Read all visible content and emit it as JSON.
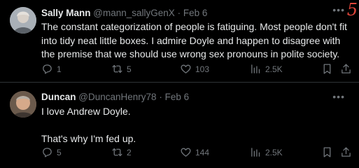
{
  "annotation": "5",
  "tweets": [
    {
      "name": "Sally Mann",
      "handle": "@mann_sallyGenX",
      "date": "Feb 6",
      "text": "The constant categorization of people is fatiguing. Most people don't fit into tidy neat little boxes. I admire Doyle and happen to disagree with the premise that we should use wrong sex pronouns in polite society.",
      "replies": "1",
      "retweets": "5",
      "likes": "103",
      "views": "2.5K"
    },
    {
      "name": "Duncan",
      "handle": "@DuncanHenry78",
      "date": "Feb 6",
      "text": "I love Andrew Doyle.\n\nThat's why I'm fed up.",
      "replies": "5",
      "retweets": "2",
      "likes": "144",
      "views": "2.5K"
    }
  ],
  "colors": {
    "background": "#000000",
    "text": "#e7e9ea",
    "secondary": "#71767b",
    "divider": "#2f3336",
    "annotation": "#e0453a"
  },
  "icons": [
    "reply-icon",
    "retweet-icon",
    "like-icon",
    "views-icon",
    "bookmark-icon",
    "share-icon",
    "more-icon"
  ]
}
